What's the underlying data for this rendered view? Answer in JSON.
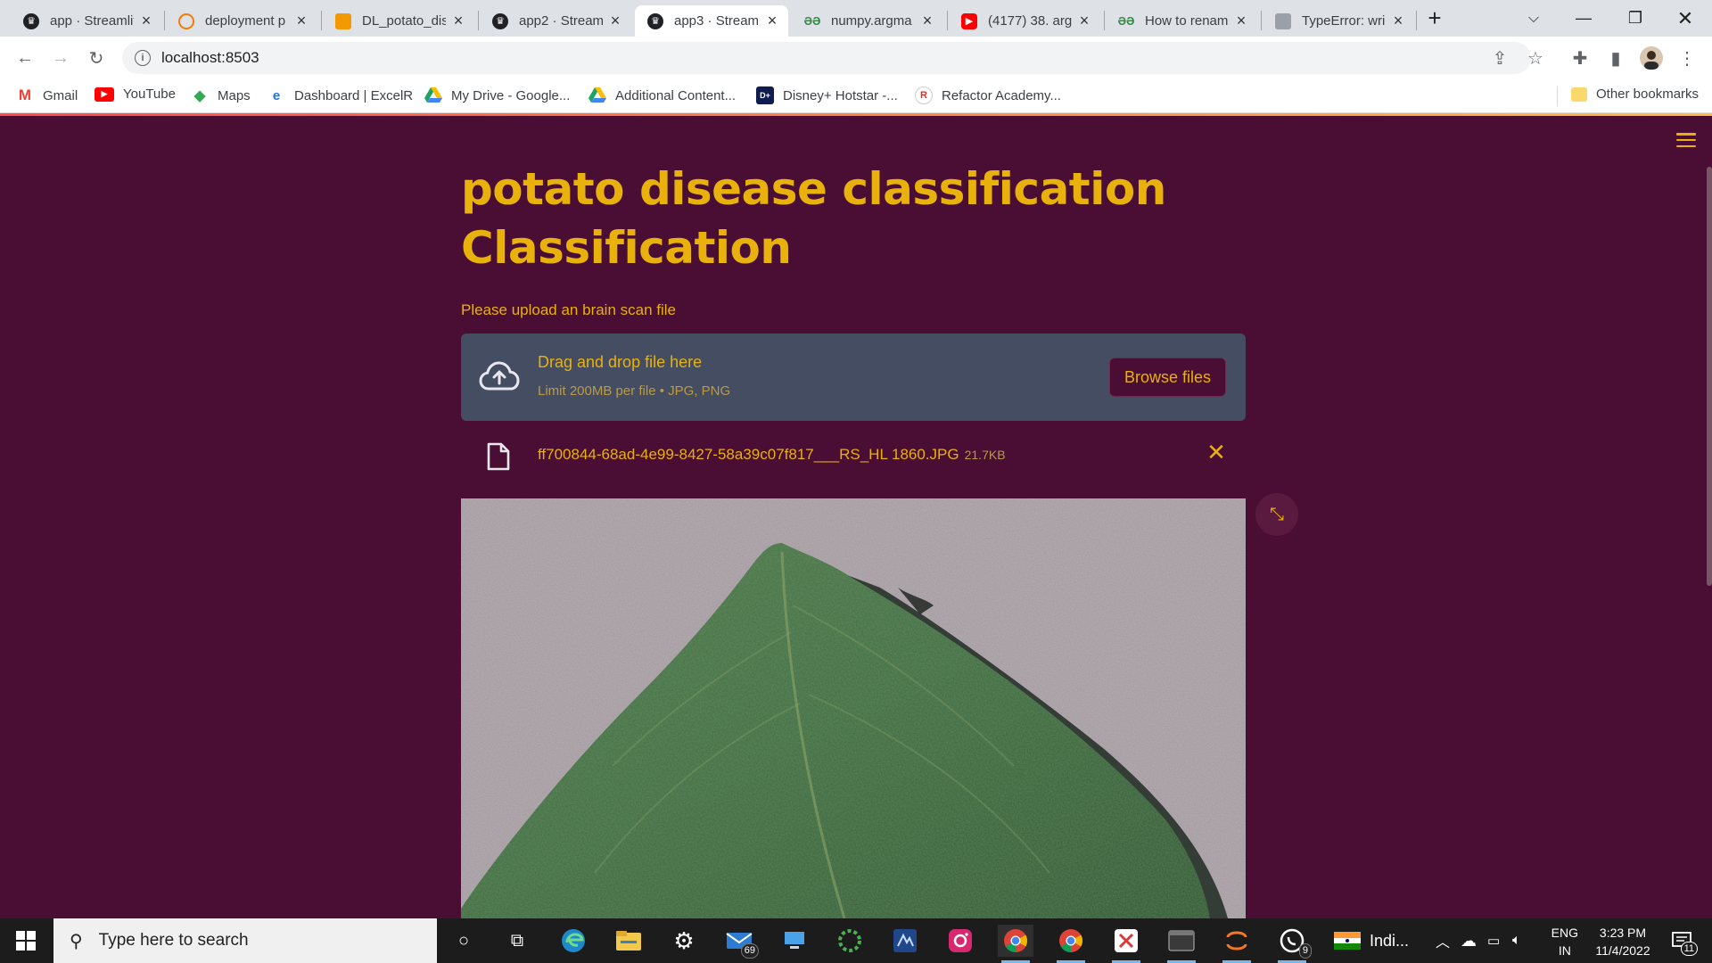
{
  "browser": {
    "tabs": [
      {
        "title": "app · Streamlit",
        "active": false
      },
      {
        "title": "deployment p",
        "active": false
      },
      {
        "title": "DL_potato_dis",
        "active": false
      },
      {
        "title": "app2 · Streaml",
        "active": false
      },
      {
        "title": "app3 · Streaml",
        "active": true
      },
      {
        "title": "numpy.argma",
        "active": false
      },
      {
        "title": "(4177) 38. arg",
        "active": false
      },
      {
        "title": "How to renam",
        "active": false
      },
      {
        "title": "TypeError: wri",
        "active": false
      }
    ],
    "new_tab": "+",
    "url": "localhost:8503",
    "bookmarks": [
      {
        "label": "Gmail",
        "icon": "gmail-icon"
      },
      {
        "label": "YouTube",
        "icon": "youtube-icon"
      },
      {
        "label": "Maps",
        "icon": "maps-icon"
      },
      {
        "label": "Dashboard | ExcelR",
        "icon": "excelr-icon"
      },
      {
        "label": "My Drive - Google...",
        "icon": "drive-icon"
      },
      {
        "label": "Additional Content...",
        "icon": "drive-icon"
      },
      {
        "label": "Disney+ Hotstar -...",
        "icon": "hotstar-icon"
      },
      {
        "label": "Refactor Academy...",
        "icon": "refactor-icon"
      }
    ],
    "other_bookmarks": "Other bookmarks"
  },
  "app": {
    "title": "potato disease classification Classification",
    "uploader_label": "Please upload an brain scan file",
    "dropzone_main": "Drag and drop file here",
    "dropzone_sub": "Limit 200MB per file • JPG, PNG",
    "browse_button": "Browse files",
    "file_name": "ff700844-68ad-4e99-8427-58a39c07f817___RS_HL 1860.JPG",
    "file_size": "21.7KB",
    "accent_color": "#e8b10c",
    "background_color": "#4a0d33"
  },
  "taskbar": {
    "search_placeholder": "Type here to search",
    "mail_badge": "69",
    "whatsapp_badge": "9",
    "weather_text": "Indi...",
    "lang_line1": "ENG",
    "lang_line2": "IN",
    "time": "3:23 PM",
    "date": "11/4/2022",
    "notification_count": "11"
  }
}
